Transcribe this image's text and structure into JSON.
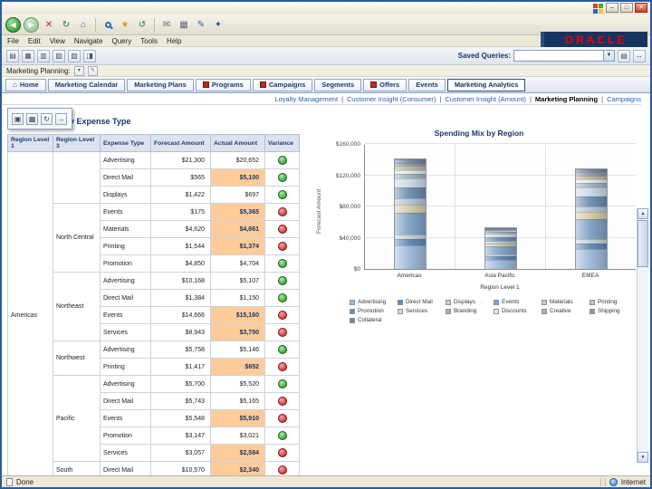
{
  "window": {
    "controls": {
      "minimize": "–",
      "maximize": "□",
      "close": "✕"
    }
  },
  "browser": {
    "menu": [
      "File",
      "Edit",
      "View",
      "Navigate",
      "Query",
      "Tools",
      "Help"
    ],
    "toolbar_icons": [
      {
        "name": "back-icon",
        "glyph": "◀",
        "cls": "circle-green"
      },
      {
        "name": "forward-icon",
        "glyph": "▶",
        "cls": "circle-pale"
      },
      {
        "name": "stop-icon",
        "glyph": "✕",
        "cls": "red"
      },
      {
        "name": "refresh-icon",
        "glyph": "↻",
        "cls": "green"
      },
      {
        "name": "home-icon",
        "glyph": "⌂",
        "cls": "blue"
      },
      {
        "sep": true
      },
      {
        "name": "search-icon",
        "glyph": "",
        "cls": "search"
      },
      {
        "name": "favorites-icon",
        "glyph": "★",
        "cls": "gold"
      },
      {
        "name": "history-icon",
        "glyph": "↺",
        "cls": "green"
      },
      {
        "sep": true
      },
      {
        "name": "mail-icon",
        "glyph": "✉",
        "cls": "gray"
      },
      {
        "name": "print-icon",
        "glyph": "▦",
        "cls": "gray"
      },
      {
        "name": "edit-icon",
        "glyph": "✎",
        "cls": "blue"
      },
      {
        "name": "messenger-icon",
        "glyph": "✦",
        "cls": "blue"
      }
    ],
    "status_left": "Done",
    "status_right": "Internet"
  },
  "oracle_logo": "ORACLE",
  "app_toolbar": {
    "icons": [
      {
        "name": "site-map-icon",
        "glyph": "▤"
      },
      {
        "name": "reports-icon",
        "glyph": "▦"
      },
      {
        "name": "chart-view-icon",
        "glyph": "▥"
      },
      {
        "name": "pivot-icon",
        "glyph": "▧"
      },
      {
        "name": "filter-icon",
        "glyph": "▨"
      },
      {
        "name": "layout-icon",
        "glyph": "◨"
      }
    ],
    "saved_queries_label": "Saved Queries:",
    "saved_queries_value": "",
    "right_icons": [
      {
        "name": "query-icon",
        "glyph": "▤"
      },
      {
        "name": "navigate-icon",
        "glyph": "↔"
      }
    ]
  },
  "breadcrumb": {
    "label": "Marketing Planning:"
  },
  "tabs": [
    {
      "label": "Home",
      "icon": "home"
    },
    {
      "label": "Marketing Calendar"
    },
    {
      "label": "Marketing Plans"
    },
    {
      "label": "Programs",
      "icon": "red"
    },
    {
      "label": "Campaigns",
      "icon": "red"
    },
    {
      "label": "Segments"
    },
    {
      "label": "Offers",
      "icon": "red"
    },
    {
      "label": "Events"
    },
    {
      "label": "Marketing Analytics",
      "icon": "chart",
      "active": true
    }
  ],
  "subnav": {
    "links": [
      {
        "label": "Loyalty Management"
      },
      {
        "label": "Customer Insight (Consumer)"
      },
      {
        "label": "Customer Insight (Amount)"
      },
      {
        "label": "Marketing Planning",
        "current": true
      },
      {
        "label": "Campaigns"
      }
    ]
  },
  "report": {
    "title": "Analysis by Expense Type",
    "toolbar_icons": [
      {
        "name": "save-icon",
        "glyph": "▣"
      },
      {
        "name": "print-icon",
        "glyph": "▦"
      },
      {
        "name": "refresh-icon",
        "glyph": "↻"
      },
      {
        "name": "export-icon",
        "glyph": "→"
      }
    ]
  },
  "table": {
    "columns": [
      "Region Level 1",
      "Region Level 3",
      "Expense Type",
      "Forecast Amount",
      "Actual Amount",
      "Variance"
    ],
    "region_level_1": "Americas",
    "groups": [
      {
        "region_level_3": "",
        "rows": [
          {
            "expense_type": "Advertising",
            "forecast": "$21,300",
            "actual": "$20,652",
            "variance": "green",
            "highlight": false
          },
          {
            "expense_type": "Direct Mail",
            "forecast": "$565",
            "actual": "$5,100",
            "variance": "green",
            "highlight": true
          },
          {
            "expense_type": "Displays",
            "forecast": "$1,422",
            "actual": "$697",
            "variance": "green",
            "highlight": false
          }
        ]
      },
      {
        "region_level_3": "North Central",
        "rows": [
          {
            "expense_type": "Events",
            "forecast": "$175",
            "actual": "$5,365",
            "variance": "red",
            "highlight": true
          },
          {
            "expense_type": "Materials",
            "forecast": "$4,620",
            "actual": "$4,661",
            "variance": "red",
            "highlight": true
          },
          {
            "expense_type": "Printing",
            "forecast": "$1,544",
            "actual": "$1,374",
            "variance": "red",
            "highlight": true
          },
          {
            "expense_type": "Promotion",
            "forecast": "$4,850",
            "actual": "$4,704",
            "variance": "green",
            "highlight": false
          }
        ]
      },
      {
        "region_level_3": "Northeast",
        "rows": [
          {
            "expense_type": "Advertising",
            "forecast": "$10,168",
            "actual": "$5,107",
            "variance": "green",
            "highlight": false
          },
          {
            "expense_type": "Direct Mail",
            "forecast": "$1,384",
            "actual": "$1,150",
            "variance": "green",
            "highlight": false
          },
          {
            "expense_type": "Events",
            "forecast": "$14,666",
            "actual": "$15,160",
            "variance": "red",
            "highlight": true
          },
          {
            "expense_type": "Services",
            "forecast": "$8,943",
            "actual": "$3,750",
            "variance": "red",
            "highlight": true
          }
        ]
      },
      {
        "region_level_3": "Northwest",
        "rows": [
          {
            "expense_type": "Advertising",
            "forecast": "$5,758",
            "actual": "$5,146",
            "variance": "green",
            "highlight": false
          },
          {
            "expense_type": "Printing",
            "forecast": "$1,417",
            "actual": "$652",
            "variance": "red",
            "highlight": true
          }
        ]
      },
      {
        "region_level_3": "Pacific",
        "rows": [
          {
            "expense_type": "Advertising",
            "forecast": "$5,700",
            "actual": "$5,520",
            "variance": "green",
            "highlight": false
          },
          {
            "expense_type": "Direct Mail",
            "forecast": "$5,743",
            "actual": "$5,165",
            "variance": "red",
            "highlight": false
          },
          {
            "expense_type": "Events",
            "forecast": "$5,548",
            "actual": "$5,910",
            "variance": "red",
            "highlight": true
          },
          {
            "expense_type": "Promotion",
            "forecast": "$3,147",
            "actual": "$3,021",
            "variance": "green",
            "highlight": false
          },
          {
            "expense_type": "Services",
            "forecast": "$3,057",
            "actual": "$2,584",
            "variance": "red",
            "highlight": true
          }
        ]
      },
      {
        "region_level_3": "South",
        "rows": [
          {
            "expense_type": "Direct Mail",
            "forecast": "$10,570",
            "actual": "$2,340",
            "variance": "red",
            "highlight": true
          }
        ]
      }
    ]
  },
  "chart_data": {
    "type": "bar",
    "stacked": true,
    "title": "Spending Mix by Region",
    "xlabel": "Region Level 1",
    "ylabel": "Forecast Amount",
    "categories": [
      "Americas",
      "Asia Pacific",
      "EMEA"
    ],
    "ylim": [
      0,
      160000
    ],
    "ytick_labels": [
      "$0",
      "$40,000",
      "$80,000",
      "$120,000",
      "$160,000"
    ],
    "legend_position": "bottom",
    "grid": true,
    "series": [
      {
        "name": "Advertising",
        "color": "#9db8d9",
        "values": [
          30000,
          12000,
          26000
        ]
      },
      {
        "name": "Direct Mail",
        "color": "#5f87b5",
        "values": [
          8000,
          4000,
          7000
        ]
      },
      {
        "name": "Displays",
        "color": "#c6cfd8",
        "values": [
          6000,
          3000,
          5000
        ]
      },
      {
        "name": "Events",
        "color": "#7fa1c4",
        "values": [
          28000,
          10000,
          26000
        ]
      },
      {
        "name": "Materials",
        "color": "#d8cba8",
        "values": [
          10000,
          4000,
          9000
        ]
      },
      {
        "name": "Printing",
        "color": "#b3c3d6",
        "values": [
          8000,
          3000,
          7000
        ]
      },
      {
        "name": "Promotion",
        "color": "#6b8cae",
        "values": [
          14000,
          5000,
          13000
        ]
      },
      {
        "name": "Services",
        "color": "#cdd9e4",
        "values": [
          12000,
          4000,
          11000
        ]
      },
      {
        "name": "Branding",
        "color": "#9fb0bf",
        "values": [
          6000,
          2000,
          6000
        ]
      },
      {
        "name": "Discounts",
        "color": "#e3e9ef",
        "values": [
          5000,
          2000,
          5000
        ]
      },
      {
        "name": "Creative",
        "color": "#bfb099",
        "values": [
          5000,
          1000,
          5000
        ]
      },
      {
        "name": "Shipping",
        "color": "#8898a8",
        "values": [
          4000,
          1000,
          4000
        ]
      },
      {
        "name": "Collateral",
        "color": "#76879a",
        "values": [
          4000,
          1000,
          4000
        ]
      }
    ]
  }
}
